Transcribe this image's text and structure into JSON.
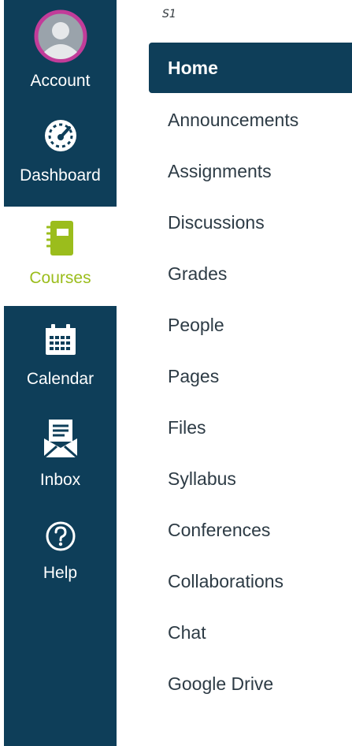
{
  "global_nav": {
    "items": [
      {
        "label": "Account",
        "icon": "avatar-icon"
      },
      {
        "label": "Dashboard",
        "icon": "dashboard-gauge-icon"
      },
      {
        "label": "Courses",
        "icon": "courses-book-icon",
        "active": true
      },
      {
        "label": "Calendar",
        "icon": "calendar-icon"
      },
      {
        "label": "Inbox",
        "icon": "inbox-envelope-icon"
      },
      {
        "label": "Help",
        "icon": "help-question-icon"
      }
    ]
  },
  "course": {
    "code": "S1"
  },
  "course_nav": {
    "items": [
      {
        "label": "Home",
        "active": true
      },
      {
        "label": "Announcements"
      },
      {
        "label": "Assignments"
      },
      {
        "label": "Discussions"
      },
      {
        "label": "Grades"
      },
      {
        "label": "People"
      },
      {
        "label": "Pages"
      },
      {
        "label": "Files"
      },
      {
        "label": "Syllabus"
      },
      {
        "label": "Conferences"
      },
      {
        "label": "Collaborations"
      },
      {
        "label": "Chat"
      },
      {
        "label": "Google Drive"
      }
    ]
  },
  "colors": {
    "nav_background": "#0e3e59",
    "active_accent": "#9bbd1c",
    "avatar_ring": "#c23c99"
  }
}
